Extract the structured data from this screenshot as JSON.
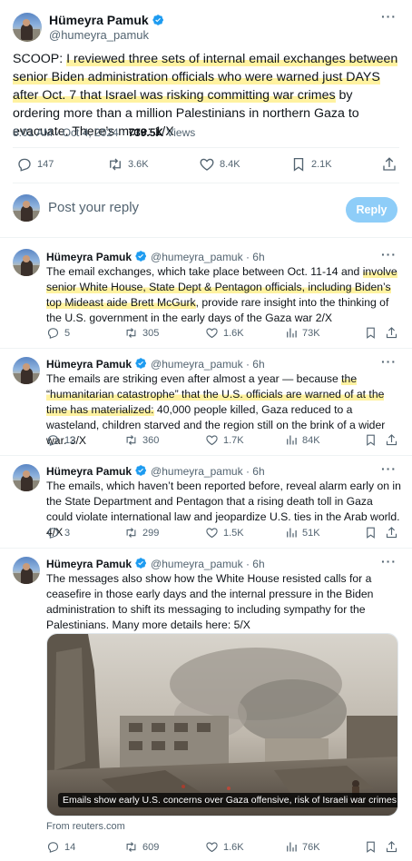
{
  "main_tweet": {
    "author_name": "Hümeyra Pamuk",
    "author_handle": "@humeyra_pamuk",
    "text_parts": [
      "SCOOP: ",
      "I reviewed three sets of internal email exchanges between senior Biden administration officials who were warned just DAYS after Oct. 7 that Israel was risking committing war crimes",
      " by ordering more than a million Palestinians in northern Gaza to evacuate. There’s more: 1/X"
    ],
    "time": "8:01 AM · Oct 4, 2024 · ",
    "views_count": "739.5K",
    "views_label": " Views",
    "stats": {
      "replies": "147",
      "reposts": "3.6K",
      "likes": "8.4K",
      "bookmarks": "2.1K"
    }
  },
  "reply_box": {
    "placeholder": "Post your reply",
    "button_label": "Reply"
  },
  "replies": [
    {
      "name": "Hümeyra Pamuk",
      "handle": "@humeyra_pamuk · 6h",
      "text_parts": [
        "The email exchanges, which take place between Oct. 11-14 and ",
        "involve senior White House, State Dept & Pentagon officials, including Biden’s top Mideast aide Brett McGurk",
        ", provide rare insight into the thinking of the U.S. government in the early days of the Gaza war 2/X"
      ],
      "stats": {
        "replies": "5",
        "reposts": "305",
        "likes": "1.6K",
        "views": "73K"
      }
    },
    {
      "name": "Hümeyra Pamuk",
      "handle": "@humeyra_pamuk · 6h",
      "text_parts": [
        "The emails are striking even after almost a year — because ",
        "the “humanitarian catastrophe” that the U.S. officials are warned of at the time has materialized:",
        " 40,000 people killed, Gaza reduced to a wasteland, children starved and the region still on the brink of a wider war. 3/X"
      ],
      "stats": {
        "replies": "12",
        "reposts": "360",
        "likes": "1.7K",
        "views": "84K"
      }
    },
    {
      "name": "Hümeyra Pamuk",
      "handle": "@humeyra_pamuk · 6h",
      "text_parts": [
        "The emails, which haven’t been reported before, reveal alarm early on in the State Department and Pentagon that a rising death toll in Gaza could violate international law and jeopardize U.S. ties in the Arab world. 4/X",
        "",
        ""
      ],
      "stats": {
        "replies": "3",
        "reposts": "299",
        "likes": "1.5K",
        "views": "51K"
      }
    },
    {
      "name": "Hümeyra Pamuk",
      "handle": "@humeyra_pamuk · 6h",
      "text_parts": [
        "The messages also show how the White House resisted calls for a ceasefire in those early days and the internal pressure in the Biden administration to shift its messaging to including sympathy for the Palestinians. Many more details here: 5/X",
        "",
        ""
      ],
      "stats": {
        "replies": "14",
        "reposts": "609",
        "likes": "1.6K",
        "views": "76K"
      }
    }
  ],
  "link_card": {
    "caption": "Emails show early U.S. concerns over Gaza offensive, risk of Israeli war crimes",
    "source": "From reuters.com"
  },
  "icons": {
    "avatar": "avatar-photo",
    "verified": "verified-badge-icon",
    "more": "more-icon",
    "reply": "reply-icon",
    "repost": "repost-icon",
    "like": "heart-icon",
    "views": "views-chart-icon",
    "bookmark": "bookmark-icon",
    "share": "share-icon"
  },
  "colors": {
    "verified": "#1d9bf0",
    "reply_button": "#8ecdf8",
    "highlight": "#fff2a0",
    "secondary_text": "#536471"
  }
}
